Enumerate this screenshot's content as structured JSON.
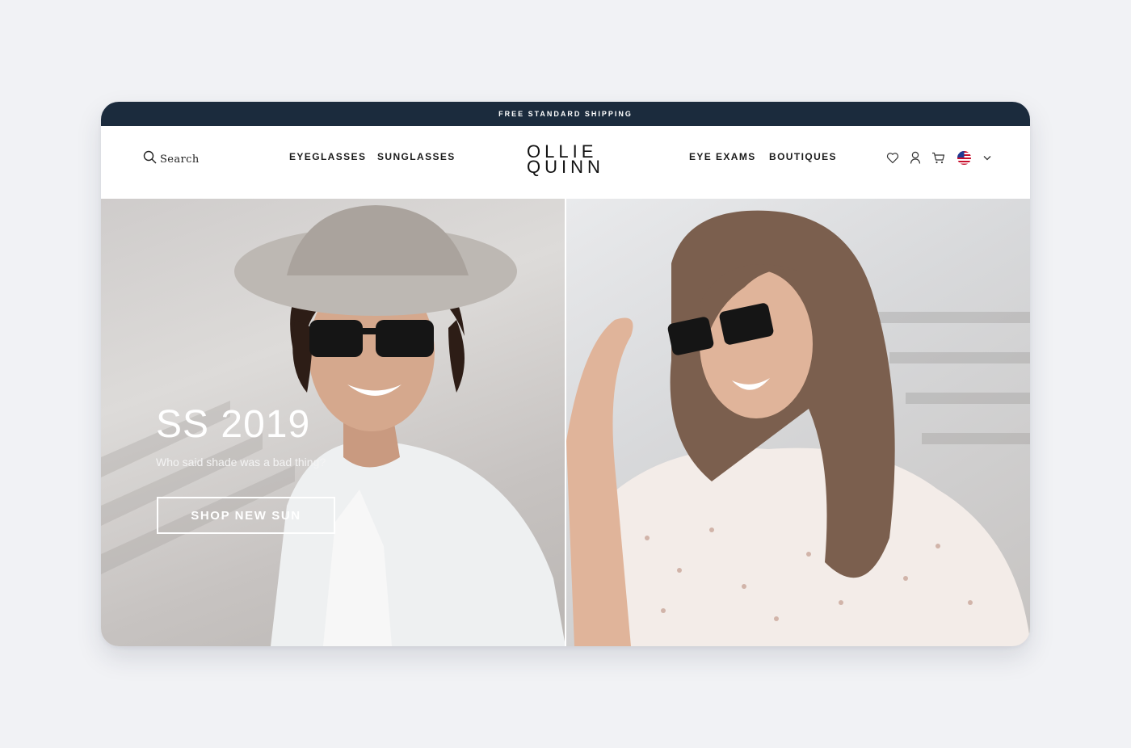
{
  "promo_bar": {
    "text": "FREE STANDARD SHIPPING"
  },
  "header": {
    "search_label": "Search",
    "nav_left": [
      {
        "label": "EYEGLASSES"
      },
      {
        "label": "SUNGLASSES"
      }
    ],
    "logo": {
      "line1": "OLLIE",
      "line2": "QUINN"
    },
    "nav_right": [
      {
        "label": "EYE EXAMS"
      },
      {
        "label": "BOUTIQUES"
      }
    ],
    "icons": [
      "heart-icon",
      "account-icon",
      "cart-icon",
      "us-flag-icon",
      "chevron-down-icon"
    ]
  },
  "hero": {
    "title": "SS 2019",
    "subtitle": "Who said shade was a bad thing?",
    "cta_label": "SHOP NEW SUN"
  },
  "colors": {
    "page_background": "#f1f2f5",
    "promo_bar": "#1b2b3d",
    "text_dark": "#1b1b1b"
  }
}
